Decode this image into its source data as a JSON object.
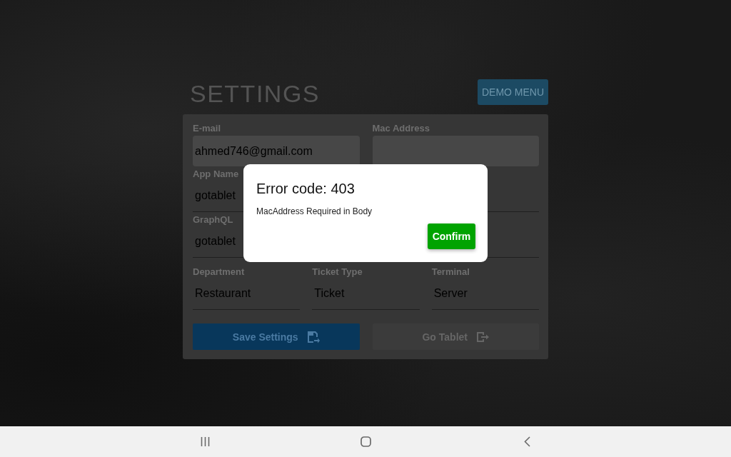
{
  "header": {
    "title": "SETTINGS",
    "menu_button": "DEMO MENU"
  },
  "form": {
    "rows": [
      {
        "fields": [
          {
            "kind": "filled",
            "label": "E-mail",
            "value": "ahmed746@gmail.com"
          },
          {
            "kind": "filled",
            "label": "Mac Address"
          }
        ]
      },
      {
        "fields": [
          {
            "kind": "underline",
            "label": "App Name",
            "value": "gotablet"
          },
          {
            "kind": "underline"
          }
        ]
      },
      {
        "fields": [
          {
            "kind": "underline",
            "label": "GraphQL",
            "value": "gotablet"
          },
          {
            "kind": "underline"
          }
        ]
      },
      {
        "fields": [
          {
            "kind": "underline",
            "label": "Department",
            "value": "Restaurant"
          },
          {
            "kind": "underline",
            "label": "Ticket Type",
            "value": "Ticket"
          },
          {
            "kind": "underline",
            "label": "Terminal",
            "value": "Server"
          }
        ]
      }
    ],
    "buttons": [
      {
        "label": "Save Settings",
        "disabled": false
      },
      {
        "label": "Go Tablet",
        "disabled": true
      }
    ]
  },
  "dialog": {
    "title": "Error code: 403",
    "message": "MacAddress Required in Body",
    "button": "Confirm"
  }
}
